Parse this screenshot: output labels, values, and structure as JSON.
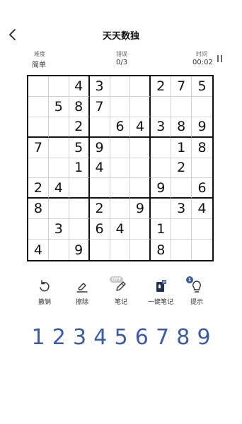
{
  "header": {
    "title": "天天数独"
  },
  "stats": {
    "difficulty_label": "难度",
    "difficulty_value": "简单",
    "mistakes_label": "错误",
    "mistakes_value": "0/3",
    "time_label": "时间",
    "time_value": "00:02"
  },
  "board": [
    [
      "",
      "",
      "4",
      "3",
      "",
      "",
      "2",
      "7",
      "5"
    ],
    [
      "",
      "5",
      "8",
      "7",
      "",
      "",
      "",
      "",
      ""
    ],
    [
      "",
      "",
      "2",
      "",
      "6",
      "4",
      "3",
      "8",
      "9"
    ],
    [
      "7",
      "",
      "5",
      "9",
      "",
      "",
      "",
      "1",
      "8"
    ],
    [
      "",
      "",
      "1",
      "4",
      "",
      "",
      "",
      "2",
      ""
    ],
    [
      "2",
      "4",
      "",
      "",
      "",
      "",
      "9",
      "",
      "6"
    ],
    [
      "8",
      "",
      "",
      "2",
      "",
      "9",
      "",
      "3",
      "4"
    ],
    [
      "",
      "3",
      "",
      "6",
      "4",
      "",
      "1",
      "",
      ""
    ],
    [
      "4",
      "",
      "9",
      "",
      "",
      "",
      "8",
      "",
      ""
    ]
  ],
  "tools": [
    {
      "label": "撤销",
      "icon": "undo-icon"
    },
    {
      "label": "擦除",
      "icon": "eraser-icon"
    },
    {
      "label": "笔记",
      "icon": "pencil-icon",
      "badge": "OFF"
    },
    {
      "label": "一键笔记",
      "icon": "auto-notes-icon"
    },
    {
      "label": "提示",
      "icon": "hint-icon",
      "badge": "1"
    }
  ],
  "numpad": [
    "1",
    "2",
    "3",
    "4",
    "5",
    "6",
    "7",
    "8",
    "9"
  ],
  "colors": {
    "accent": "#3a5ca8",
    "grid_thick": "#111111",
    "grid_thin": "#cfcfcf"
  }
}
